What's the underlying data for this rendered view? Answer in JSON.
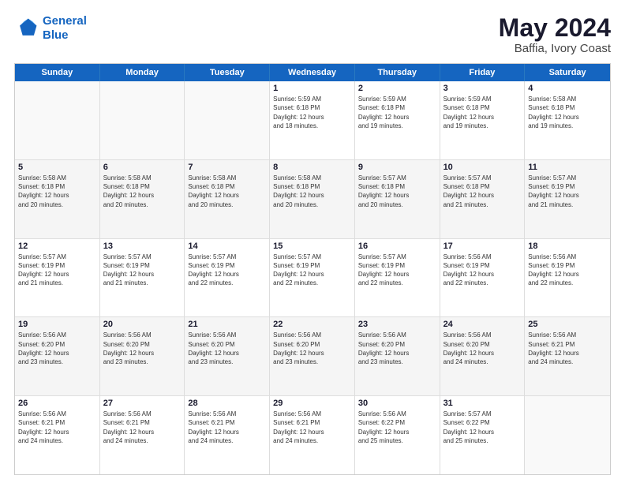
{
  "logo": {
    "line1": "General",
    "line2": "Blue"
  },
  "title": "May 2024",
  "subtitle": "Baffia, Ivory Coast",
  "days": [
    "Sunday",
    "Monday",
    "Tuesday",
    "Wednesday",
    "Thursday",
    "Friday",
    "Saturday"
  ],
  "rows": [
    [
      {
        "num": "",
        "text": ""
      },
      {
        "num": "",
        "text": ""
      },
      {
        "num": "",
        "text": ""
      },
      {
        "num": "1",
        "text": "Sunrise: 5:59 AM\nSunset: 6:18 PM\nDaylight: 12 hours\nand 18 minutes."
      },
      {
        "num": "2",
        "text": "Sunrise: 5:59 AM\nSunset: 6:18 PM\nDaylight: 12 hours\nand 19 minutes."
      },
      {
        "num": "3",
        "text": "Sunrise: 5:59 AM\nSunset: 6:18 PM\nDaylight: 12 hours\nand 19 minutes."
      },
      {
        "num": "4",
        "text": "Sunrise: 5:58 AM\nSunset: 6:18 PM\nDaylight: 12 hours\nand 19 minutes."
      }
    ],
    [
      {
        "num": "5",
        "text": "Sunrise: 5:58 AM\nSunset: 6:18 PM\nDaylight: 12 hours\nand 20 minutes."
      },
      {
        "num": "6",
        "text": "Sunrise: 5:58 AM\nSunset: 6:18 PM\nDaylight: 12 hours\nand 20 minutes."
      },
      {
        "num": "7",
        "text": "Sunrise: 5:58 AM\nSunset: 6:18 PM\nDaylight: 12 hours\nand 20 minutes."
      },
      {
        "num": "8",
        "text": "Sunrise: 5:58 AM\nSunset: 6:18 PM\nDaylight: 12 hours\nand 20 minutes."
      },
      {
        "num": "9",
        "text": "Sunrise: 5:57 AM\nSunset: 6:18 PM\nDaylight: 12 hours\nand 20 minutes."
      },
      {
        "num": "10",
        "text": "Sunrise: 5:57 AM\nSunset: 6:18 PM\nDaylight: 12 hours\nand 21 minutes."
      },
      {
        "num": "11",
        "text": "Sunrise: 5:57 AM\nSunset: 6:19 PM\nDaylight: 12 hours\nand 21 minutes."
      }
    ],
    [
      {
        "num": "12",
        "text": "Sunrise: 5:57 AM\nSunset: 6:19 PM\nDaylight: 12 hours\nand 21 minutes."
      },
      {
        "num": "13",
        "text": "Sunrise: 5:57 AM\nSunset: 6:19 PM\nDaylight: 12 hours\nand 21 minutes."
      },
      {
        "num": "14",
        "text": "Sunrise: 5:57 AM\nSunset: 6:19 PM\nDaylight: 12 hours\nand 22 minutes."
      },
      {
        "num": "15",
        "text": "Sunrise: 5:57 AM\nSunset: 6:19 PM\nDaylight: 12 hours\nand 22 minutes."
      },
      {
        "num": "16",
        "text": "Sunrise: 5:57 AM\nSunset: 6:19 PM\nDaylight: 12 hours\nand 22 minutes."
      },
      {
        "num": "17",
        "text": "Sunrise: 5:56 AM\nSunset: 6:19 PM\nDaylight: 12 hours\nand 22 minutes."
      },
      {
        "num": "18",
        "text": "Sunrise: 5:56 AM\nSunset: 6:19 PM\nDaylight: 12 hours\nand 22 minutes."
      }
    ],
    [
      {
        "num": "19",
        "text": "Sunrise: 5:56 AM\nSunset: 6:20 PM\nDaylight: 12 hours\nand 23 minutes."
      },
      {
        "num": "20",
        "text": "Sunrise: 5:56 AM\nSunset: 6:20 PM\nDaylight: 12 hours\nand 23 minutes."
      },
      {
        "num": "21",
        "text": "Sunrise: 5:56 AM\nSunset: 6:20 PM\nDaylight: 12 hours\nand 23 minutes."
      },
      {
        "num": "22",
        "text": "Sunrise: 5:56 AM\nSunset: 6:20 PM\nDaylight: 12 hours\nand 23 minutes."
      },
      {
        "num": "23",
        "text": "Sunrise: 5:56 AM\nSunset: 6:20 PM\nDaylight: 12 hours\nand 23 minutes."
      },
      {
        "num": "24",
        "text": "Sunrise: 5:56 AM\nSunset: 6:20 PM\nDaylight: 12 hours\nand 24 minutes."
      },
      {
        "num": "25",
        "text": "Sunrise: 5:56 AM\nSunset: 6:21 PM\nDaylight: 12 hours\nand 24 minutes."
      }
    ],
    [
      {
        "num": "26",
        "text": "Sunrise: 5:56 AM\nSunset: 6:21 PM\nDaylight: 12 hours\nand 24 minutes."
      },
      {
        "num": "27",
        "text": "Sunrise: 5:56 AM\nSunset: 6:21 PM\nDaylight: 12 hours\nand 24 minutes."
      },
      {
        "num": "28",
        "text": "Sunrise: 5:56 AM\nSunset: 6:21 PM\nDaylight: 12 hours\nand 24 minutes."
      },
      {
        "num": "29",
        "text": "Sunrise: 5:56 AM\nSunset: 6:21 PM\nDaylight: 12 hours\nand 24 minutes."
      },
      {
        "num": "30",
        "text": "Sunrise: 5:56 AM\nSunset: 6:22 PM\nDaylight: 12 hours\nand 25 minutes."
      },
      {
        "num": "31",
        "text": "Sunrise: 5:57 AM\nSunset: 6:22 PM\nDaylight: 12 hours\nand 25 minutes."
      },
      {
        "num": "",
        "text": ""
      }
    ]
  ]
}
